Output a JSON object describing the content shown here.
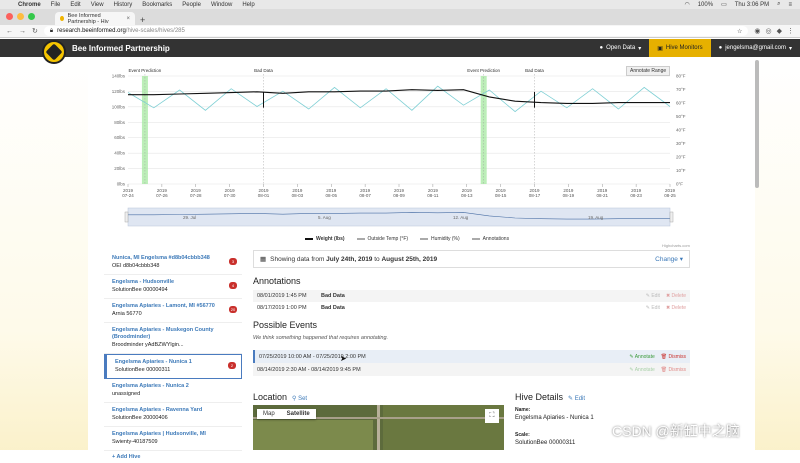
{
  "mac_menu": {
    "app": "Chrome",
    "items": [
      "File",
      "Edit",
      "View",
      "History",
      "Bookmarks",
      "People",
      "Window",
      "Help"
    ],
    "battery": "100%",
    "clock": "Thu 3:06 PM"
  },
  "browser": {
    "tab_title": "Bee Informed Partnership - Hiv",
    "url_host": "research.beeinformed.org",
    "url_path": "/hive-scales/hives/285"
  },
  "navbar": {
    "brand": "Bee Informed Partnership",
    "open_data": "Open Data",
    "hive_monitors": "Hive Monitors",
    "user": "jengelsma@gmail.com"
  },
  "chart_data": {
    "type": "line",
    "x_ticks": [
      "2019\n07-24",
      "2019\n07-26",
      "2019\n07-28",
      "2019\n07-30",
      "2019\n08-01",
      "2019\n08-03",
      "2019\n08-05",
      "2019\n08-07",
      "2019\n08-09",
      "2019\n08-11",
      "2019\n08-13",
      "2019\n08-15",
      "2019\n08-17",
      "2019\n08-19",
      "2019\n08-21",
      "2019\n08-23",
      "2019\n08-25"
    ],
    "y_left_ticks": [
      "140lbs",
      "120lbs",
      "100lbs",
      "80lbs",
      "60lbs",
      "40lbs",
      "20lbs",
      "0lbs"
    ],
    "y_right_ticks": [
      "80°F",
      "70°F",
      "60°F",
      "50°F",
      "40°F",
      "30°F",
      "20°F",
      "10°F",
      "0°F"
    ],
    "ylim_left": [
      0,
      150
    ],
    "ylim_right": [
      0,
      85
    ],
    "annotations_on_chart": [
      {
        "label": "Event Prediction",
        "date": "07-25"
      },
      {
        "label": "Bad Data",
        "date": "08-01"
      },
      {
        "label": "Event Prediction",
        "date": "08-14"
      },
      {
        "label": "Bad Data",
        "date": "08-17"
      }
    ],
    "highlight_ranges": [
      [
        "07-25",
        "07-25"
      ],
      [
        "08-14",
        "08-14"
      ]
    ],
    "series": [
      {
        "name": "Weight (lbs)",
        "color": "#111111",
        "values": [
          124,
          124,
          125,
          126,
          127,
          128,
          126,
          128,
          128,
          129,
          129,
          131,
          130,
          131,
          121,
          115,
          113,
          112,
          112,
          113,
          113,
          113
        ]
      },
      {
        "name": "Outside Temp (°F)",
        "color": "#7ecfd4",
        "values": [
          72,
          60,
          74,
          58,
          75,
          61,
          73,
          59,
          76,
          60,
          75,
          58,
          77,
          62,
          74,
          57,
          73,
          60,
          75,
          59,
          76,
          61
        ]
      }
    ],
    "navigator_labels": [
      "29. Jul",
      "5. Aug",
      "12. Aug",
      "19. Aug"
    ],
    "legend": [
      "Weight (lbs)",
      "Outside Temp (°F)",
      "Humidity (%)",
      "Annotations"
    ],
    "annotate_range_button": "Annotate Range",
    "credit": "Highcharts.com"
  },
  "hives": [
    {
      "name": "Nunica, MI Engelsma #d8b04cbbb348",
      "sub": "OEI d8b04cbbb348",
      "badge": "3"
    },
    {
      "name": "Engelsma - Hudsonville",
      "sub": "SolutionBee 00000494",
      "badge": "4"
    },
    {
      "name": "Engelsma Apiaries - Lamont, MI #56770",
      "sub": "Arnia 56770",
      "badge": "20"
    },
    {
      "name": "Engelsma Apiaries - Muskegon County (Broodminder)",
      "sub": "Broodminder yAdBZWYlgin...",
      "badge": ""
    },
    {
      "name": "Engelsma Apiaries - Nunica 1",
      "sub": "SolutionBee 00000311",
      "badge": "2"
    },
    {
      "name": "Engelsma Apiaries - Nunica 2",
      "sub": "unassigned",
      "badge": ""
    },
    {
      "name": "Engelsma Apiaries - Ravenna Yard",
      "sub": "SolutionBee 20000406",
      "badge": ""
    },
    {
      "name": "Engelsma Apiaries | Hudsonville, MI",
      "sub": "Swienty-40187509",
      "badge": ""
    }
  ],
  "add_hive": "Add Hive",
  "range": {
    "prefix": "Showing data from",
    "start": "July 24th, 2019",
    "mid": "to",
    "end": "August 25th, 2019",
    "change": "Change"
  },
  "annotations": {
    "title": "Annotations",
    "rows": [
      {
        "date": "08/01/2019 1:45 PM",
        "type": "Bad Data"
      },
      {
        "date": "08/17/2019 1:00 PM",
        "type": "Bad Data"
      }
    ],
    "edit": "Edit",
    "delete": "Delete"
  },
  "events": {
    "title": "Possible Events",
    "note": "We think something happened that requires annotating.",
    "rows": [
      {
        "range": "07/25/2019 10:00 AM - 07/25/2019 2:00 PM"
      },
      {
        "range": "08/14/2019 2:30 AM - 08/14/2019 9:45 PM"
      }
    ],
    "annotate": "Annotate",
    "dismiss": "Dismiss"
  },
  "location": {
    "title": "Location",
    "set": "Set",
    "map_tab": "Map",
    "satellite_tab": "Satellite"
  },
  "hive_details": {
    "title": "Hive Details",
    "edit": "Edit",
    "name_label": "Name:",
    "name_value": "Engelsma Apiaries - Nunica 1",
    "scale_label": "Scale:",
    "scale_value": "SolutionBee 00000311"
  },
  "watermark": "CSDN @新缸中之脑"
}
